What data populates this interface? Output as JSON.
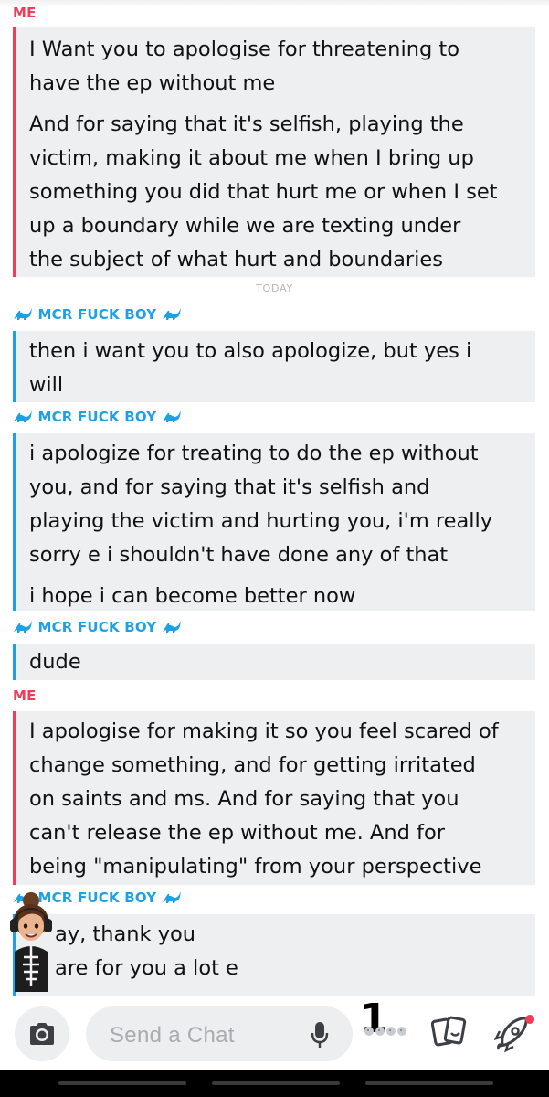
{
  "senders": {
    "me": "ME",
    "them": "MCR FUCK BOY"
  },
  "divider": "TODAY",
  "messages": [
    {
      "from": "me",
      "paragraphs": [
        [
          "I Want you to apologise for threatening to",
          "have the ep without me"
        ],
        [
          "And for saying that it's selfish, playing the",
          "victim, making it about me when I bring up",
          "something you did that hurt me or when I set",
          "up a boundary while we are texting under",
          "the subject of what hurt and boundaries"
        ]
      ]
    },
    {
      "from": "them",
      "paragraphs": [
        [
          "then i want you to also apologize, but yes i",
          "will"
        ]
      ]
    },
    {
      "from": "them",
      "paragraphs": [
        [
          "i apologize for treating to do the ep without",
          "you, and for saying that it's selfish and",
          "playing the victim and hurting you, i'm really",
          "sorry e i shouldn't have done any of that"
        ],
        [
          "i hope i can become better now"
        ]
      ]
    },
    {
      "from": "them",
      "paragraphs": [
        [
          "dude"
        ]
      ]
    },
    {
      "from": "me",
      "paragraphs": [
        [
          "I apologise for making it so you feel scared of",
          "change something, and for getting irritated",
          "on saints and ms. And for saying that you",
          "can't release the ep without me. And for",
          "being \"manipulating\" from your perspective"
        ]
      ]
    },
    {
      "from": "them",
      "paragraphs": [
        [
          "ay, thank you",
          "are for you a lot e"
        ]
      ]
    }
  ],
  "chatbar": {
    "placeholder": "Send a Chat",
    "typing_count": "1",
    "icons": [
      "camera-icon",
      "microphone-icon",
      "bitmoji-typing-icon",
      "stickers-icon",
      "games-rocket-icon"
    ]
  },
  "colors": {
    "me": "#f23c57",
    "them": "#1ea0e6",
    "bubble": "#eeeff1",
    "notification": "#f23c57"
  }
}
